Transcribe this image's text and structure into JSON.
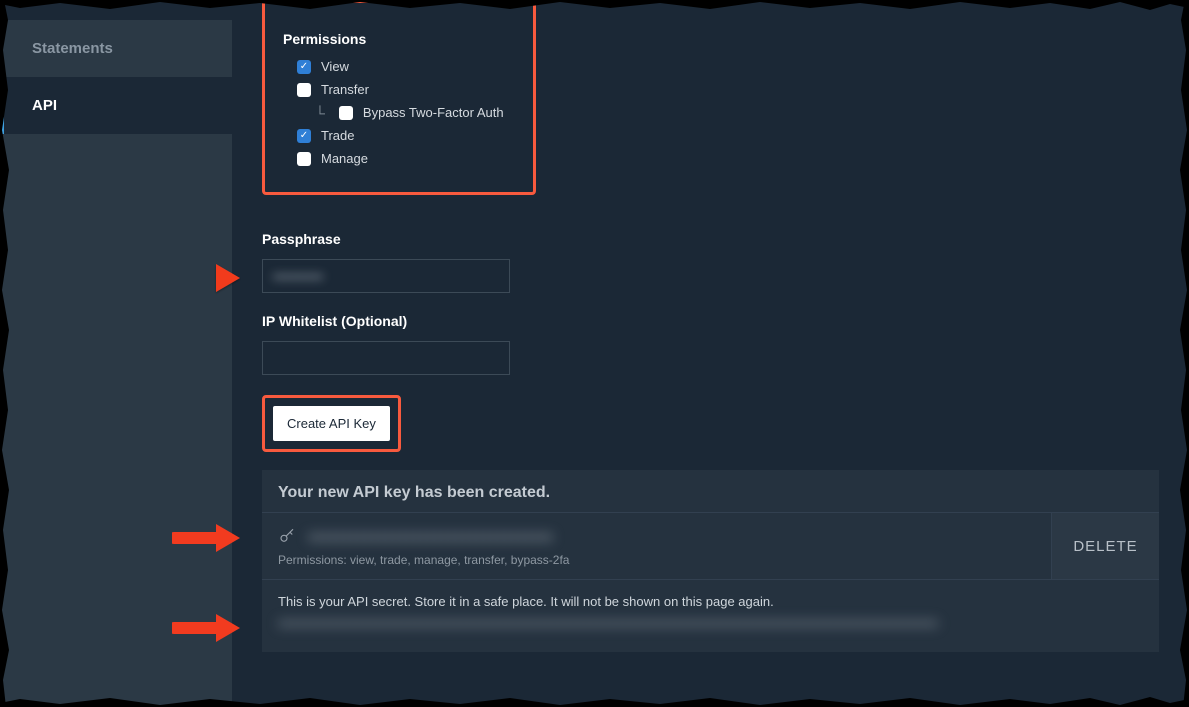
{
  "sidebar": {
    "items": [
      {
        "label": "Statements",
        "active": false
      },
      {
        "label": "API",
        "active": true
      }
    ]
  },
  "permissions": {
    "title": "Permissions",
    "items": {
      "view": {
        "label": "View",
        "checked": true
      },
      "transfer": {
        "label": "Transfer",
        "checked": false
      },
      "bypass": {
        "label": "Bypass Two-Factor Auth",
        "checked": false
      },
      "trade": {
        "label": "Trade",
        "checked": true
      },
      "manage": {
        "label": "Manage",
        "checked": false
      }
    }
  },
  "passphrase": {
    "label": "Passphrase",
    "value": "•••••••••••"
  },
  "ip_whitelist": {
    "label": "IP Whitelist (Optional)",
    "value": ""
  },
  "create_button": "Create API Key",
  "result": {
    "title": "Your new API key has been created.",
    "key_value": "xxxxxxxxxxxxxxxxxxxxxxxxxxxxxxxxxxx",
    "permissions_summary": "Permissions: view, trade, manage, transfer, bypass-2fa",
    "delete_label": "DELETE",
    "secret_notice": "This is your API secret. Store it in a safe place. It will not be shown on this page again.",
    "secret_value": "xxxxxxxxxxxxxxxxxxxxxxxxxxxxxxxxxxxxxxxxxxxxxxxxxxxxxxxxxxxxxxxxxxxxxxxxxxxxxxxxxxxxxxxxxxxxxxxxxxxxxxxxxxxxxxxxxxxxxxxxxxxxxxx"
  }
}
